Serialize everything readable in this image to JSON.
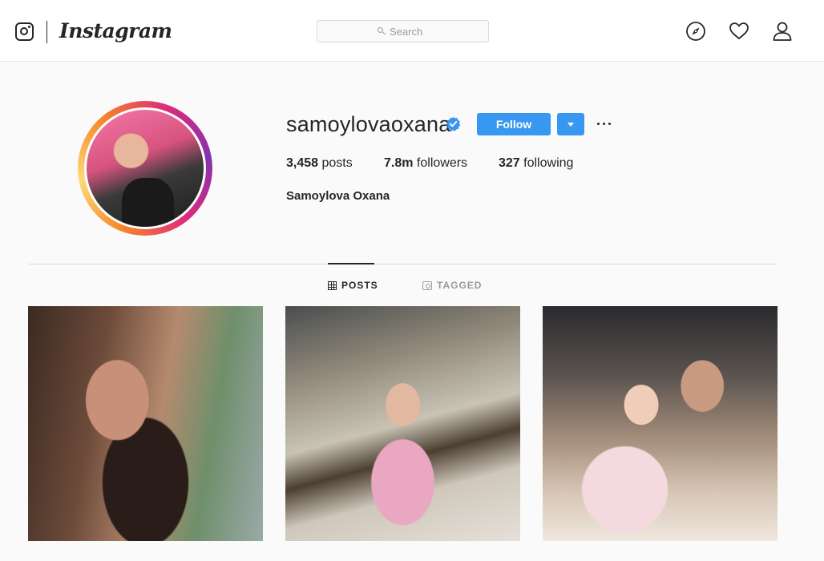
{
  "app": {
    "wordmark": "Instagram"
  },
  "search": {
    "placeholder": "Search"
  },
  "nav": {
    "icons": [
      "explore-icon",
      "heart-icon",
      "profile-icon"
    ]
  },
  "profile": {
    "username": "samoylovaoxana",
    "verified": true,
    "follow_label": "Follow",
    "full_name": "Samoylova Oxana",
    "stats": {
      "posts_count": "3,458",
      "posts_label": "posts",
      "followers_count": "7.8m",
      "followers_label": "followers",
      "following_count": "327",
      "following_label": "following"
    }
  },
  "tabs": [
    {
      "label": "POSTS",
      "active": true
    },
    {
      "label": "TAGGED",
      "active": false
    }
  ],
  "colors": {
    "accent": "#3897f0",
    "verified": "#3897f0",
    "text": "#262626",
    "muted": "#999999"
  }
}
